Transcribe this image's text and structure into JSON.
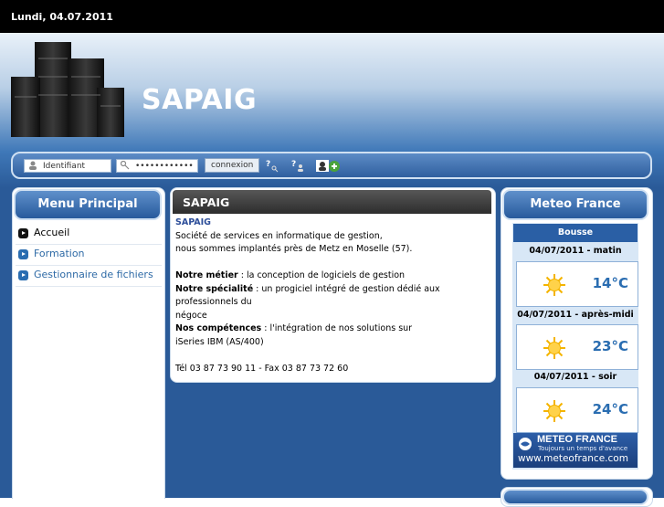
{
  "header": {
    "date": "Lundi, 04.07.2011"
  },
  "site": {
    "title": "SAPAIG"
  },
  "login": {
    "username_placeholder": "Identifiant",
    "password_value": "••••••••••••",
    "submit_label": "connexion"
  },
  "menu": {
    "title": "Menu Principal",
    "items": [
      {
        "label": "Accueil",
        "active": true
      },
      {
        "label": "Formation",
        "active": false
      },
      {
        "label": "Gestionnaire de fichiers",
        "active": false
      }
    ]
  },
  "article": {
    "title": "SAPAIG",
    "subtitle": "SAPAIG",
    "lines": [
      "Société de services en informatique de gestion,",
      "nous sommes implantés près de Metz en Moselle (57)."
    ],
    "metier_label": "Notre métier",
    "metier_text": " : la conception de logiciels de gestion",
    "specialite_label": "Notre spécialité",
    "specialite_text": " : un progiciel intégré de gestion dédié aux professionnels du",
    "specialite_text2": "négoce",
    "competences_label": "Nos compétences",
    "competences_text": " : l'intégration de nos solutions sur",
    "competences_text2": "iSeries IBM (AS/400)",
    "contact": "Tél  03 87 73 90 11 - Fax 03 87 73 72 60"
  },
  "weather": {
    "title": "Meteo France",
    "city": "Bousse",
    "forecasts": [
      {
        "label": "04/07/2011 - matin",
        "temp": "14°C",
        "icon": "sun-icon"
      },
      {
        "label": "04/07/2011 - après-midi",
        "temp": "23°C",
        "icon": "sun-icon"
      },
      {
        "label": "04/07/2011 - soir",
        "temp": "24°C",
        "icon": "sun-icon"
      }
    ],
    "logo_main": "METEO FRANCE",
    "logo_tagline": "Toujours un temps d'avance",
    "logo_url": "www.meteofrance.com"
  },
  "colors": {
    "accent": "#2a6db1",
    "header_bg": "#000000",
    "panel_head": "#3a6fb0"
  }
}
